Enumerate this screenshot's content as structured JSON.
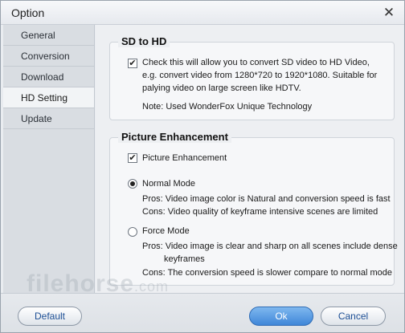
{
  "window": {
    "title": "Option",
    "close_glyph": "✕"
  },
  "sidebar": {
    "items": [
      {
        "label": "General",
        "active": false
      },
      {
        "label": "Conversion",
        "active": false
      },
      {
        "label": "Download",
        "active": false
      },
      {
        "label": "HD Setting",
        "active": true
      },
      {
        "label": "Update",
        "active": false
      }
    ]
  },
  "sd_to_hd": {
    "title": "SD to HD",
    "checked": true,
    "description": "Check this will allow you to convert SD video to HD Video, e.g. convert video from 1280*720 to 1920*1080. Suitable for palying video on large screen like HDTV.",
    "note": "Note: Used WonderFox Unique Technology"
  },
  "picture_enhancement": {
    "title": "Picture Enhancement",
    "checkbox_label": "Picture Enhancement",
    "checked": true,
    "normal_mode": {
      "label": "Normal Mode",
      "selected": true,
      "pros": "Pros: Video image color is Natural and conversion speed is fast",
      "cons": "Cons: Video quality of keyframe intensive scenes are limited"
    },
    "force_mode": {
      "label": "Force Mode",
      "selected": false,
      "pros_line1": "Pros: Video image is clear and sharp on all scenes include dense",
      "pros_line2": "keyframes",
      "cons": "Cons: The conversion speed is slower compare to normal mode"
    }
  },
  "footer": {
    "default_label": "Default",
    "ok_label": "Ok",
    "cancel_label": "Cancel"
  },
  "watermark": {
    "text": "filehorse",
    "suffix": ".com"
  },
  "colors": {
    "ok_button": "#3f86d8",
    "button_text": "#1d4f95",
    "active_tab": "#f2f4f6"
  }
}
